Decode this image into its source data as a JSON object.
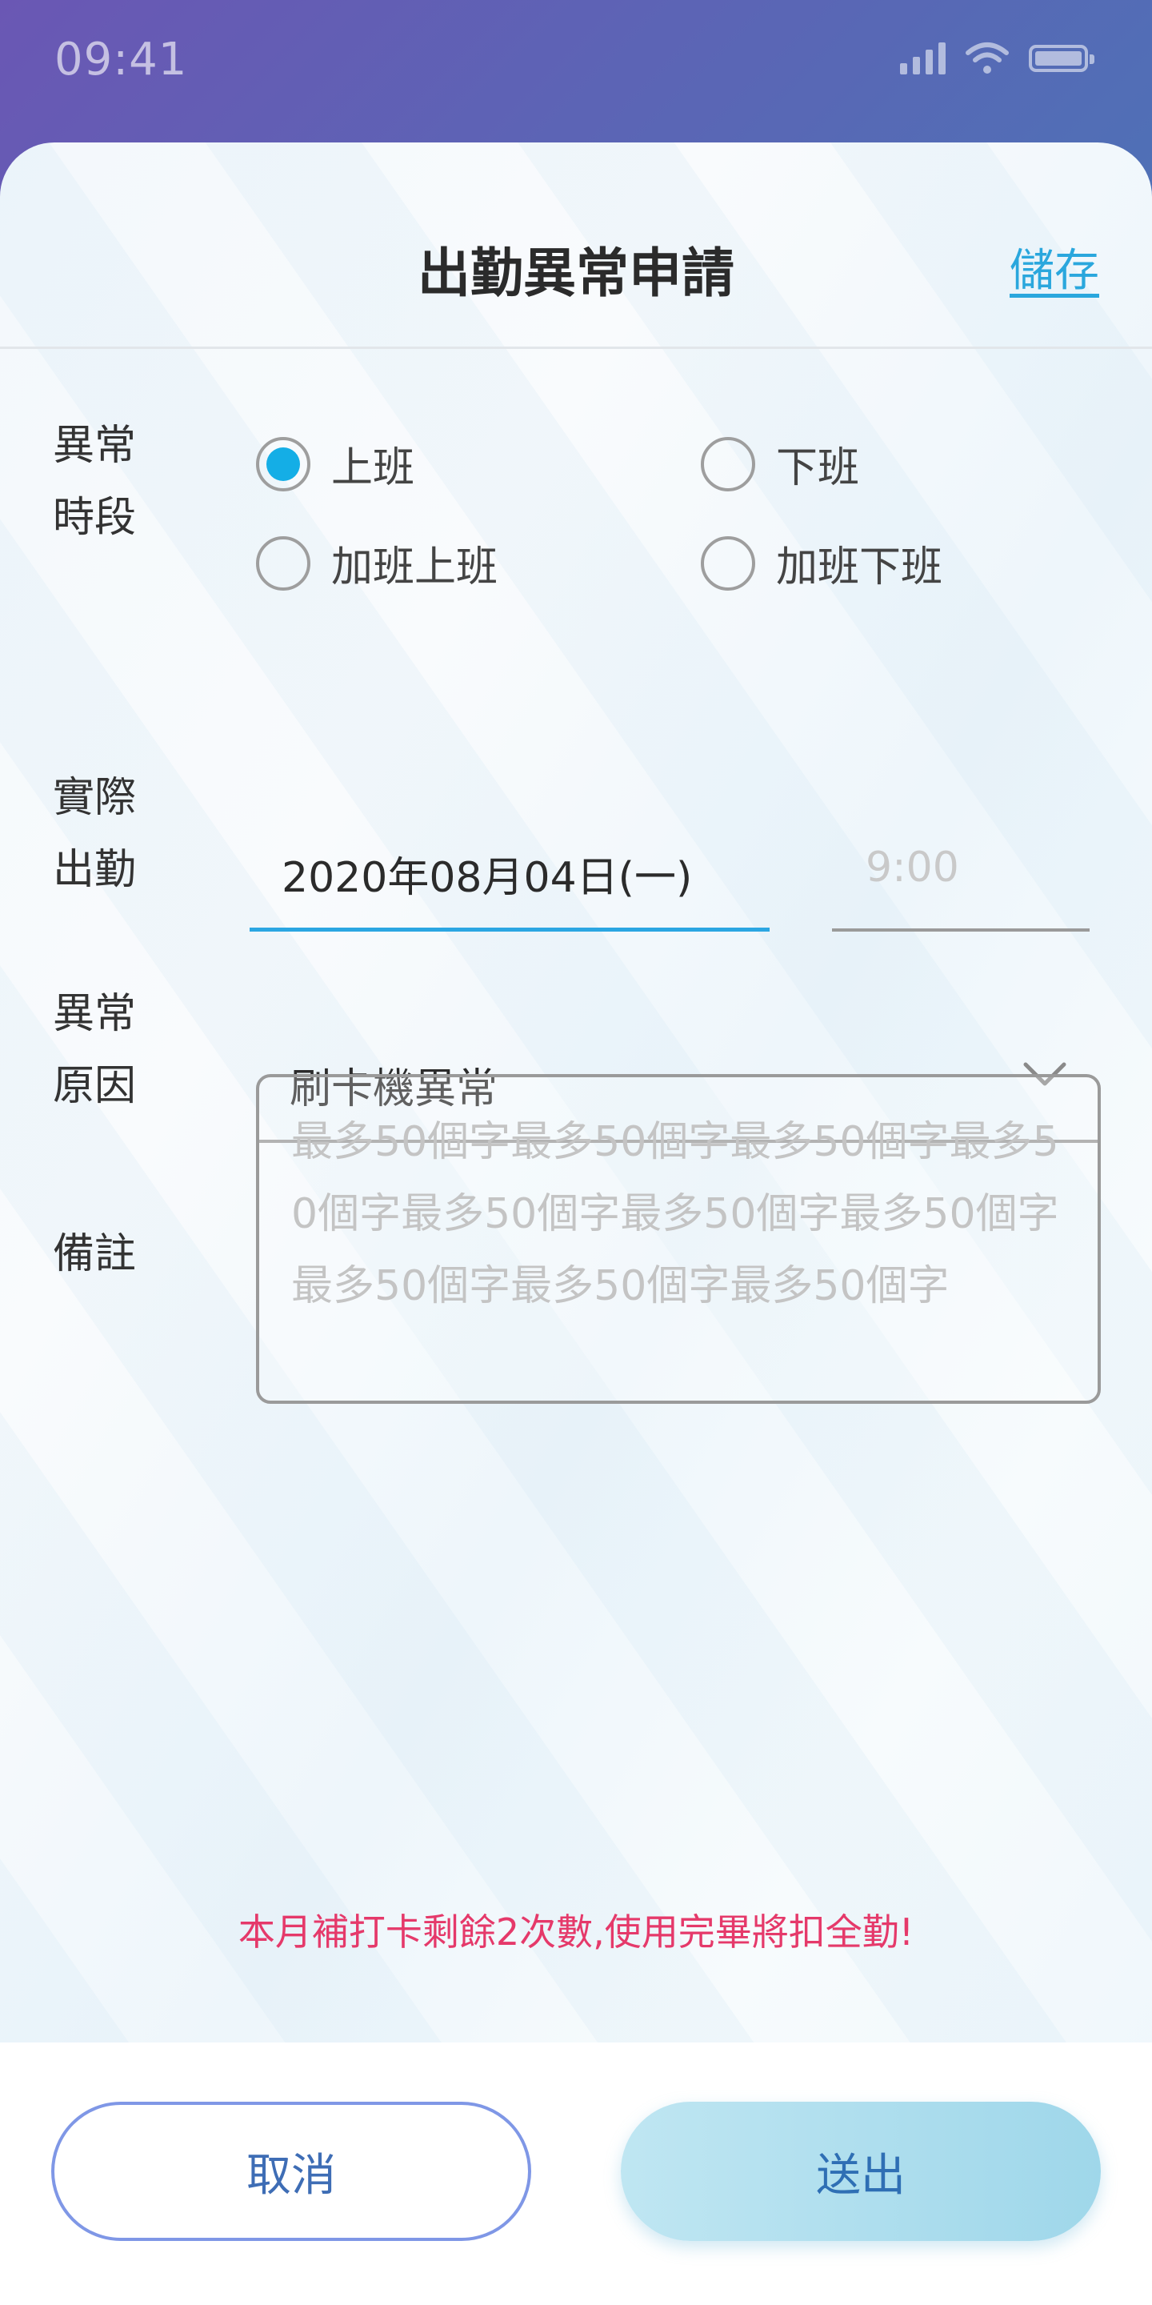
{
  "status_bar": {
    "time": "09:41",
    "icons": [
      "signal-icon",
      "wifi-icon",
      "battery-icon"
    ]
  },
  "header": {
    "title": "出勤異常申請",
    "save_label": "儲存"
  },
  "form": {
    "period": {
      "label_line1": "異常",
      "label_line2": "時段",
      "options": [
        {
          "label": "上班",
          "checked": true
        },
        {
          "label": "下班",
          "checked": false
        },
        {
          "label": "加班上班",
          "checked": false
        },
        {
          "label": "加班下班",
          "checked": false
        }
      ]
    },
    "actual": {
      "label_line1": "實際",
      "label_line2": "出勤",
      "date_value": "2020年08月04日(一)",
      "time_placeholder": "9:00"
    },
    "reason": {
      "label_line1": "異常",
      "label_line2": "原因",
      "selected": "刷卡機異常"
    },
    "note": {
      "label": "備註",
      "placeholder": "最多50個字最多50個字最多50個字最多50個字最多50個字最多50個字最多50個字最多50個字最多50個字最多50個字"
    }
  },
  "warning": "本月補打卡剩餘2次數,使用完畢將扣全勤!",
  "footer": {
    "cancel_label": "取消",
    "submit_label": "送出"
  },
  "colors": {
    "accent": "#14aee6",
    "warning": "#e5396a",
    "link": "#2aa7dd",
    "button_text": "#3e6db5"
  }
}
